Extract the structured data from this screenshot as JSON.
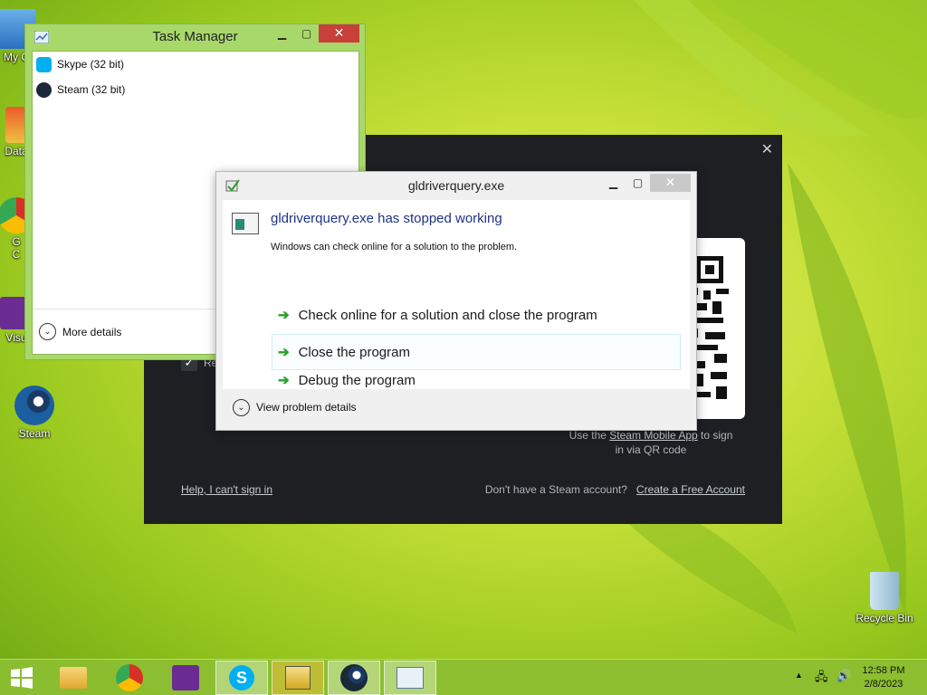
{
  "desktop": {
    "icons": [
      {
        "label": "My C"
      },
      {
        "label": "Data"
      },
      {
        "label": "G\nC"
      },
      {
        "label": "Visu"
      },
      {
        "label": "Steam"
      },
      {
        "label": "Recycle Bin"
      }
    ]
  },
  "steam_login": {
    "checkbox_label": "Re",
    "qr_caption_prefix": "Use the ",
    "qr_caption_link": "Steam Mobile App",
    "qr_caption_suffix": " to sign",
    "qr_caption_line2": "in via QR code",
    "help_link": "Help, I can't sign in",
    "no_account_text": "Don't have a Steam account?",
    "create_account_link": "Create a Free Account"
  },
  "task_manager": {
    "title": "Task Manager",
    "processes": [
      {
        "name": "Skype (32 bit)",
        "icon": "skype-icon"
      },
      {
        "name": "Steam (32 bit)",
        "icon": "steam-icon"
      }
    ],
    "more_details": "More details"
  },
  "error_dialog": {
    "title": "gldriverquery.exe",
    "heading": "gldriverquery.exe has stopped working",
    "subtext": "Windows can check online for a solution to the problem.",
    "options": [
      "Check online for a solution and close the program",
      "Close the program",
      "Debug the program"
    ],
    "view_details": "View problem details"
  },
  "taskbar": {
    "time": "12:58 PM",
    "date": "2/8/2023"
  },
  "colors": {
    "taskbar": "#8cbe32",
    "task_manager_frame": "#a9d86a",
    "close_button": "#c7403a",
    "link_blue": "#1e3287",
    "arrow_green": "#2aa02a",
    "steam_bg": "#1e1f23"
  }
}
